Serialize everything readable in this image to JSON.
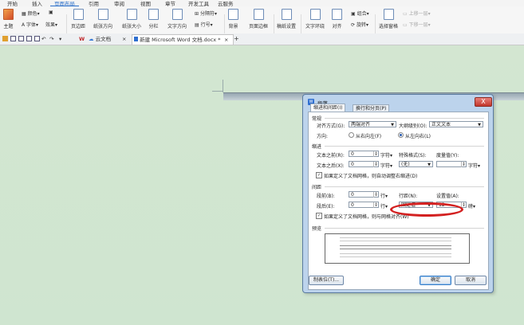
{
  "menubar": [
    "开始",
    "插入",
    "页面布局",
    "引用",
    "审阅",
    "视图",
    "章节",
    "开发工具",
    "云服务"
  ],
  "ribbon": {
    "theme": "主题",
    "colors": "颜色",
    "fonts": "字体",
    "effects": "效果",
    "margins": "页边距",
    "orientation": "纸张方向",
    "size": "纸张大小",
    "columns": "分栏",
    "text_direction": "文字方向",
    "breaks": "分隔符",
    "line_numbers": "行号",
    "background": "背景",
    "page_border": "页面边框",
    "paper_settings": "稿纸设置",
    "text_wrap": "文字环绕",
    "align": "对齐",
    "group": "组合",
    "rotate": "旋转",
    "selection_pane": "选择窗格",
    "bring_forward": "上移一层",
    "send_backward": "下移一层"
  },
  "tabs": {
    "cloud": "云文档",
    "doc": "新建 Microsoft Word 文档.docx *"
  },
  "dialog": {
    "title": "段落",
    "close": "X",
    "tab1": "缩进和间距(I)",
    "tab2": "换行和分页(P)",
    "general": "常规",
    "alignment_label": "对齐方式(G):",
    "alignment_value": "两端对齐",
    "outline_label": "大纲级别(O):",
    "outline_value": "正文文本",
    "direction_label": "方向:",
    "rtl": "从右向左(F)",
    "ltr": "从左向右(L)",
    "indent": "缩进",
    "before_text_label": "文本之前(R):",
    "before_text_value": "0",
    "after_text_label": "文本之后(X):",
    "after_text_value": "0",
    "unit_char": "字符▾",
    "special_label": "特殊格式(S):",
    "special_value": "(无)",
    "measure_label": "度量值(Y):",
    "auto_indent": "如果定义了文档网格，则自动调整右缩进(D)",
    "spacing": "间距",
    "before_label": "段前(B):",
    "before_value": "0",
    "after_label": "段后(E):",
    "after_value": "0",
    "unit_line": "行▾",
    "line_spacing_label": "行距(N):",
    "line_spacing_value": "固定值",
    "setting_label": "设置值(A):",
    "setting_value": "12",
    "unit_pound": "磅▾",
    "snap_grid": "如果定义了文档网格，则与网格对齐(W)",
    "preview": "预览",
    "tabs_button": "制表位(T)...",
    "ok": "确定",
    "cancel": "取消"
  }
}
